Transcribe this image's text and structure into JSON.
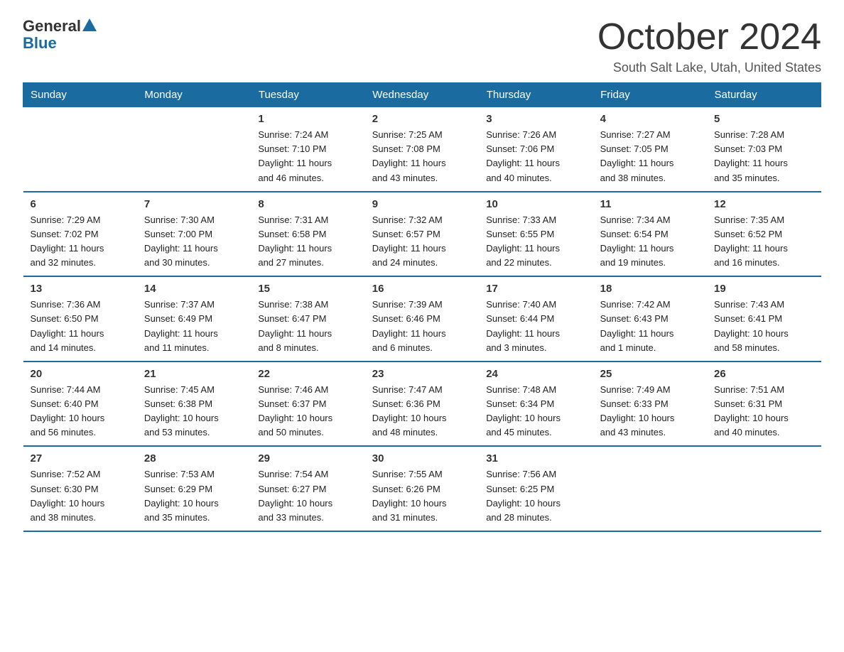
{
  "logo": {
    "general": "General",
    "blue": "Blue"
  },
  "title": "October 2024",
  "subtitle": "South Salt Lake, Utah, United States",
  "days_header": [
    "Sunday",
    "Monday",
    "Tuesday",
    "Wednesday",
    "Thursday",
    "Friday",
    "Saturday"
  ],
  "weeks": [
    [
      {
        "num": "",
        "detail": ""
      },
      {
        "num": "",
        "detail": ""
      },
      {
        "num": "1",
        "detail": "Sunrise: 7:24 AM\nSunset: 7:10 PM\nDaylight: 11 hours\nand 46 minutes."
      },
      {
        "num": "2",
        "detail": "Sunrise: 7:25 AM\nSunset: 7:08 PM\nDaylight: 11 hours\nand 43 minutes."
      },
      {
        "num": "3",
        "detail": "Sunrise: 7:26 AM\nSunset: 7:06 PM\nDaylight: 11 hours\nand 40 minutes."
      },
      {
        "num": "4",
        "detail": "Sunrise: 7:27 AM\nSunset: 7:05 PM\nDaylight: 11 hours\nand 38 minutes."
      },
      {
        "num": "5",
        "detail": "Sunrise: 7:28 AM\nSunset: 7:03 PM\nDaylight: 11 hours\nand 35 minutes."
      }
    ],
    [
      {
        "num": "6",
        "detail": "Sunrise: 7:29 AM\nSunset: 7:02 PM\nDaylight: 11 hours\nand 32 minutes."
      },
      {
        "num": "7",
        "detail": "Sunrise: 7:30 AM\nSunset: 7:00 PM\nDaylight: 11 hours\nand 30 minutes."
      },
      {
        "num": "8",
        "detail": "Sunrise: 7:31 AM\nSunset: 6:58 PM\nDaylight: 11 hours\nand 27 minutes."
      },
      {
        "num": "9",
        "detail": "Sunrise: 7:32 AM\nSunset: 6:57 PM\nDaylight: 11 hours\nand 24 minutes."
      },
      {
        "num": "10",
        "detail": "Sunrise: 7:33 AM\nSunset: 6:55 PM\nDaylight: 11 hours\nand 22 minutes."
      },
      {
        "num": "11",
        "detail": "Sunrise: 7:34 AM\nSunset: 6:54 PM\nDaylight: 11 hours\nand 19 minutes."
      },
      {
        "num": "12",
        "detail": "Sunrise: 7:35 AM\nSunset: 6:52 PM\nDaylight: 11 hours\nand 16 minutes."
      }
    ],
    [
      {
        "num": "13",
        "detail": "Sunrise: 7:36 AM\nSunset: 6:50 PM\nDaylight: 11 hours\nand 14 minutes."
      },
      {
        "num": "14",
        "detail": "Sunrise: 7:37 AM\nSunset: 6:49 PM\nDaylight: 11 hours\nand 11 minutes."
      },
      {
        "num": "15",
        "detail": "Sunrise: 7:38 AM\nSunset: 6:47 PM\nDaylight: 11 hours\nand 8 minutes."
      },
      {
        "num": "16",
        "detail": "Sunrise: 7:39 AM\nSunset: 6:46 PM\nDaylight: 11 hours\nand 6 minutes."
      },
      {
        "num": "17",
        "detail": "Sunrise: 7:40 AM\nSunset: 6:44 PM\nDaylight: 11 hours\nand 3 minutes."
      },
      {
        "num": "18",
        "detail": "Sunrise: 7:42 AM\nSunset: 6:43 PM\nDaylight: 11 hours\nand 1 minute."
      },
      {
        "num": "19",
        "detail": "Sunrise: 7:43 AM\nSunset: 6:41 PM\nDaylight: 10 hours\nand 58 minutes."
      }
    ],
    [
      {
        "num": "20",
        "detail": "Sunrise: 7:44 AM\nSunset: 6:40 PM\nDaylight: 10 hours\nand 56 minutes."
      },
      {
        "num": "21",
        "detail": "Sunrise: 7:45 AM\nSunset: 6:38 PM\nDaylight: 10 hours\nand 53 minutes."
      },
      {
        "num": "22",
        "detail": "Sunrise: 7:46 AM\nSunset: 6:37 PM\nDaylight: 10 hours\nand 50 minutes."
      },
      {
        "num": "23",
        "detail": "Sunrise: 7:47 AM\nSunset: 6:36 PM\nDaylight: 10 hours\nand 48 minutes."
      },
      {
        "num": "24",
        "detail": "Sunrise: 7:48 AM\nSunset: 6:34 PM\nDaylight: 10 hours\nand 45 minutes."
      },
      {
        "num": "25",
        "detail": "Sunrise: 7:49 AM\nSunset: 6:33 PM\nDaylight: 10 hours\nand 43 minutes."
      },
      {
        "num": "26",
        "detail": "Sunrise: 7:51 AM\nSunset: 6:31 PM\nDaylight: 10 hours\nand 40 minutes."
      }
    ],
    [
      {
        "num": "27",
        "detail": "Sunrise: 7:52 AM\nSunset: 6:30 PM\nDaylight: 10 hours\nand 38 minutes."
      },
      {
        "num": "28",
        "detail": "Sunrise: 7:53 AM\nSunset: 6:29 PM\nDaylight: 10 hours\nand 35 minutes."
      },
      {
        "num": "29",
        "detail": "Sunrise: 7:54 AM\nSunset: 6:27 PM\nDaylight: 10 hours\nand 33 minutes."
      },
      {
        "num": "30",
        "detail": "Sunrise: 7:55 AM\nSunset: 6:26 PM\nDaylight: 10 hours\nand 31 minutes."
      },
      {
        "num": "31",
        "detail": "Sunrise: 7:56 AM\nSunset: 6:25 PM\nDaylight: 10 hours\nand 28 minutes."
      },
      {
        "num": "",
        "detail": ""
      },
      {
        "num": "",
        "detail": ""
      }
    ]
  ]
}
